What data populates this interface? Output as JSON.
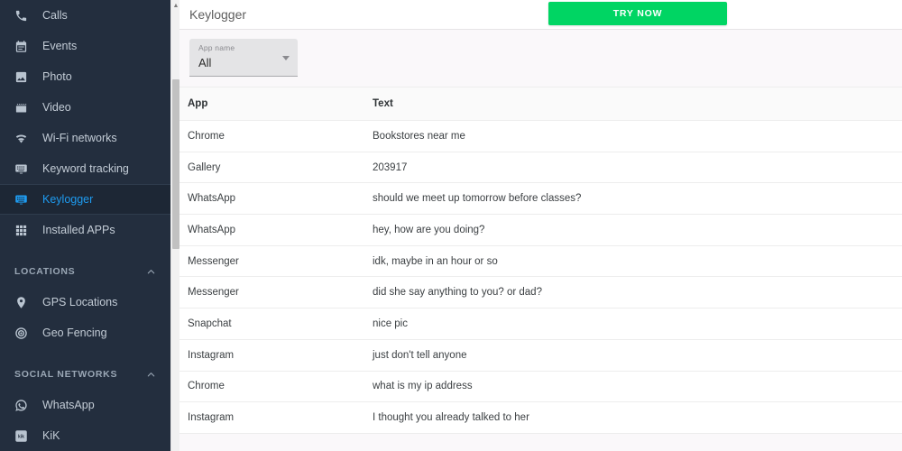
{
  "sidebar": {
    "items": [
      {
        "label": "Calls",
        "icon": "phone-icon",
        "active": false
      },
      {
        "label": "Events",
        "icon": "calendar-icon",
        "active": false
      },
      {
        "label": "Photo",
        "icon": "photo-icon",
        "active": false
      },
      {
        "label": "Video",
        "icon": "video-icon",
        "active": false
      },
      {
        "label": "Wi-Fi networks",
        "icon": "wifi-icon",
        "active": false
      },
      {
        "label": "Keyword tracking",
        "icon": "keyboard-icon",
        "active": false
      },
      {
        "label": "Keylogger",
        "icon": "keyboard-icon",
        "active": true
      },
      {
        "label": "Installed APPs",
        "icon": "grid-apps-icon",
        "active": false
      }
    ],
    "sections": [
      {
        "title": "LOCATIONS",
        "collapse_icon": "chevron-up-icon",
        "items": [
          {
            "label": "GPS Locations",
            "icon": "map-pin-icon"
          },
          {
            "label": "Geo Fencing",
            "icon": "target-icon"
          }
        ]
      },
      {
        "title": "SOCIAL NETWORKS",
        "collapse_icon": "chevron-up-icon",
        "items": [
          {
            "label": "WhatsApp",
            "icon": "whatsapp-icon"
          },
          {
            "label": "KiK",
            "icon": "kik-icon"
          }
        ]
      }
    ],
    "scrollbar": {
      "up_arrow_icon": "chevron-up-icon"
    },
    "colors": {
      "background": "#232e3e",
      "active_accent": "#1e9bf0",
      "label": "#c3ccd6"
    }
  },
  "header": {
    "title": "Keylogger",
    "try_now_label": "TRY NOW",
    "try_now_color": "#00d563"
  },
  "filters": {
    "app_name": {
      "label": "App name",
      "value": "All",
      "caret_icon": "caret-down-icon"
    }
  },
  "table": {
    "columns": [
      "App",
      "Text"
    ],
    "rows": [
      {
        "app": "Chrome",
        "text": "Bookstores near me"
      },
      {
        "app": "Gallery",
        "text": "203917"
      },
      {
        "app": "WhatsApp",
        "text": "should we meet up tomorrow before classes?"
      },
      {
        "app": "WhatsApp",
        "text": "hey, how are you doing?"
      },
      {
        "app": "Messenger",
        "text": "idk, maybe in an hour or so"
      },
      {
        "app": "Messenger",
        "text": "did she say anything to you? or dad?"
      },
      {
        "app": "Snapchat",
        "text": "nice pic"
      },
      {
        "app": "Instagram",
        "text": "just don't tell anyone"
      },
      {
        "app": "Chrome",
        "text": "what is my ip address"
      },
      {
        "app": "Instagram",
        "text": "I thought you already talked to her"
      }
    ]
  }
}
